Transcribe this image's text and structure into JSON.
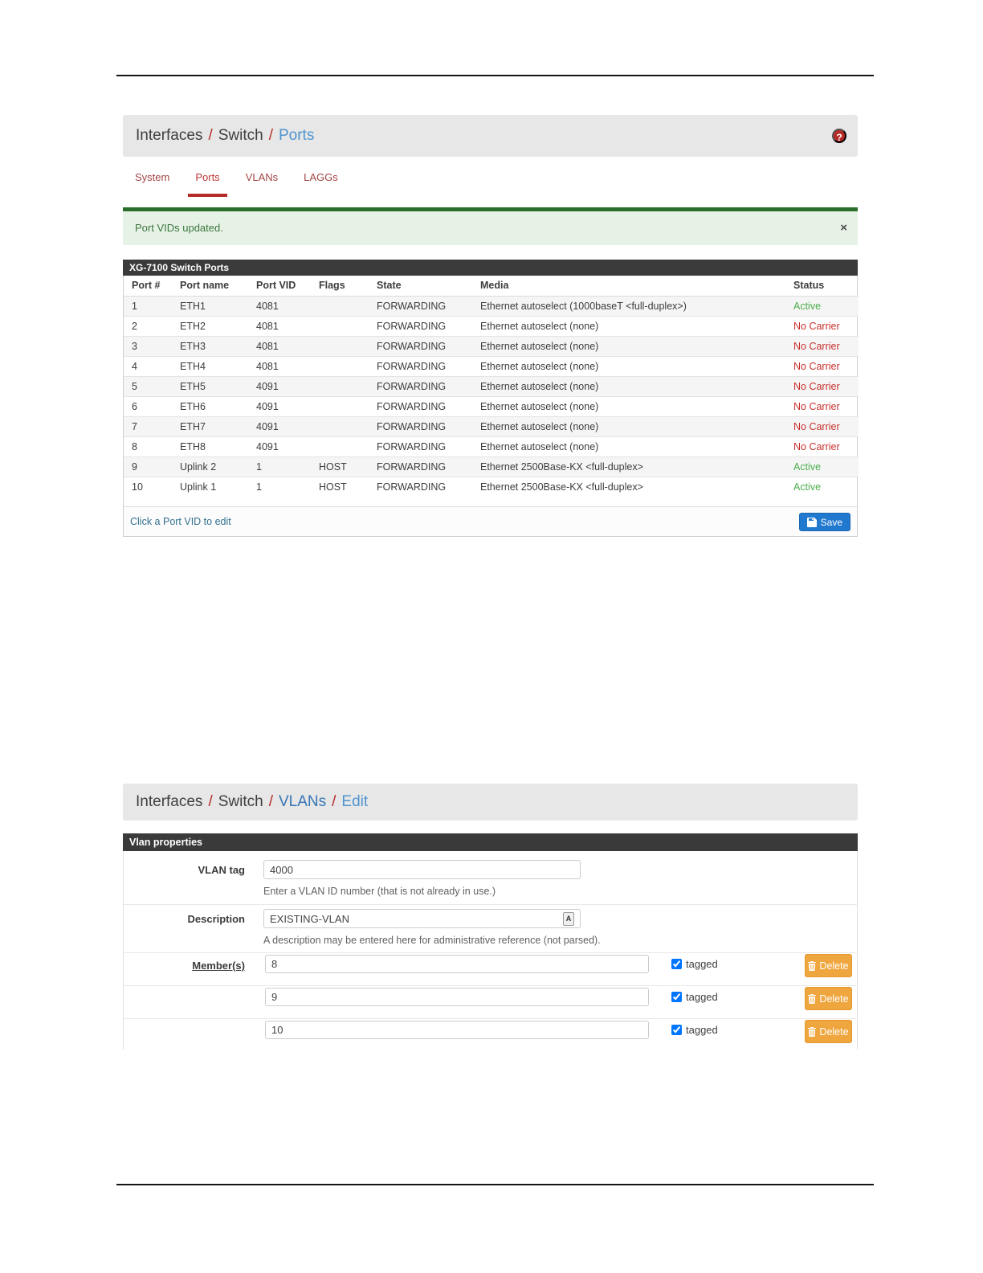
{
  "sep": "/",
  "help_label": "?",
  "ports_page": {
    "breadcrumb": {
      "a": "Interfaces",
      "b": "Switch",
      "c": "Ports"
    },
    "tabs": {
      "system": "System",
      "ports": "Ports",
      "vlans": "VLANs",
      "laggs": "LAGGs"
    },
    "alert": {
      "message": "Port VIDs updated.",
      "close": "×"
    },
    "panel_title": "XG-7100 Switch Ports",
    "columns": {
      "port": "Port #",
      "name": "Port name",
      "vid": "Port VID",
      "flags": "Flags",
      "state": "State",
      "media": "Media",
      "status": "Status"
    },
    "rows": [
      {
        "port": "1",
        "name": "ETH1",
        "vid": "4081",
        "flags": "",
        "state": "FORWARDING",
        "media": "Ethernet autoselect (1000baseT <full-duplex>)",
        "status": "Active"
      },
      {
        "port": "2",
        "name": "ETH2",
        "vid": "4081",
        "flags": "",
        "state": "FORWARDING",
        "media": "Ethernet autoselect (none)",
        "status": "No Carrier"
      },
      {
        "port": "3",
        "name": "ETH3",
        "vid": "4081",
        "flags": "",
        "state": "FORWARDING",
        "media": "Ethernet autoselect (none)",
        "status": "No Carrier"
      },
      {
        "port": "4",
        "name": "ETH4",
        "vid": "4081",
        "flags": "",
        "state": "FORWARDING",
        "media": "Ethernet autoselect (none)",
        "status": "No Carrier"
      },
      {
        "port": "5",
        "name": "ETH5",
        "vid": "4091",
        "flags": "",
        "state": "FORWARDING",
        "media": "Ethernet autoselect (none)",
        "status": "No Carrier"
      },
      {
        "port": "6",
        "name": "ETH6",
        "vid": "4091",
        "flags": "",
        "state": "FORWARDING",
        "media": "Ethernet autoselect (none)",
        "status": "No Carrier"
      },
      {
        "port": "7",
        "name": "ETH7",
        "vid": "4091",
        "flags": "",
        "state": "FORWARDING",
        "media": "Ethernet autoselect (none)",
        "status": "No Carrier"
      },
      {
        "port": "8",
        "name": "ETH8",
        "vid": "4091",
        "flags": "",
        "state": "FORWARDING",
        "media": "Ethernet autoselect (none)",
        "status": "No Carrier"
      },
      {
        "port": "9",
        "name": "Uplink 2",
        "vid": "1",
        "flags": "HOST",
        "state": "FORWARDING",
        "media": "Ethernet 2500Base-KX <full-duplex>",
        "status": "Active"
      },
      {
        "port": "10",
        "name": "Uplink 1",
        "vid": "1",
        "flags": "HOST",
        "state": "FORWARDING",
        "media": "Ethernet 2500Base-KX <full-duplex>",
        "status": "Active"
      }
    ],
    "footer": {
      "link": "Click a Port VID to edit",
      "save": "Save"
    }
  },
  "vlan_page": {
    "breadcrumb": {
      "a": "Interfaces",
      "b": "Switch",
      "c": "VLANs",
      "d": "Edit"
    },
    "panel_title": "Vlan properties",
    "vlan_tag": {
      "label": "VLAN tag",
      "value": "4000",
      "help": "Enter a VLAN ID number (that is not already in use.)"
    },
    "description": {
      "label": "Description",
      "value": "EXISTING-VLAN",
      "addon_icon": "A",
      "help": "A description may be entered here for administrative reference (not parsed)."
    },
    "members": {
      "label": "Member(s)",
      "tagged": "tagged",
      "delete": "Delete",
      "rows": [
        {
          "value": "8"
        },
        {
          "value": "9"
        },
        {
          "value": "10"
        }
      ]
    }
  },
  "colors": {
    "accent_red": "#b52b27",
    "breadcrumb_link_blue": "#3576b5",
    "success_green": "#4cae4c",
    "danger_red": "#c9302c",
    "warning_orange": "#f0a63e",
    "primary_blue": "#2179cf",
    "alert_bg": "#e7f2e7",
    "panel_header_bg": "#3a3a3a"
  }
}
